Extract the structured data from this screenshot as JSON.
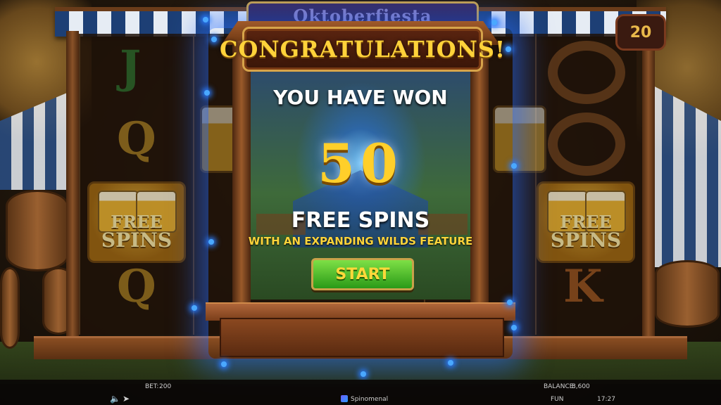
{
  "game": {
    "logo_text": "Oktoberfiesta",
    "lines_count": "20"
  },
  "popup": {
    "header": "CONGRATULATIONS!",
    "won_text": "YOU HAVE WON",
    "amount": "50",
    "prize_label": "FREE SPINS",
    "feature_text": "WITH AN EXPANDING WILDS FEATURE",
    "start_label": "START"
  },
  "reels": {
    "left_symbols": [
      "J",
      "Q",
      "Q"
    ],
    "right_symbols": [
      "K"
    ],
    "free_spins_symbol_top": "FREE",
    "free_spins_symbol_bottom": "SPINS"
  },
  "bottom_bar": {
    "bet_label": "BET:",
    "bet_value": "200",
    "balance_label": "BALANCE:",
    "balance_value": "8,600",
    "provider": "Spinomenal",
    "mode": "FUN",
    "time": "17:27"
  },
  "icons": [
    "sound-icon",
    "turbo-icon",
    "spinomenal-logo-icon"
  ],
  "colors": {
    "accent_gold": "#ffd23a",
    "button_green": "#2a9a18",
    "glow_blue": "#2a7cff"
  }
}
